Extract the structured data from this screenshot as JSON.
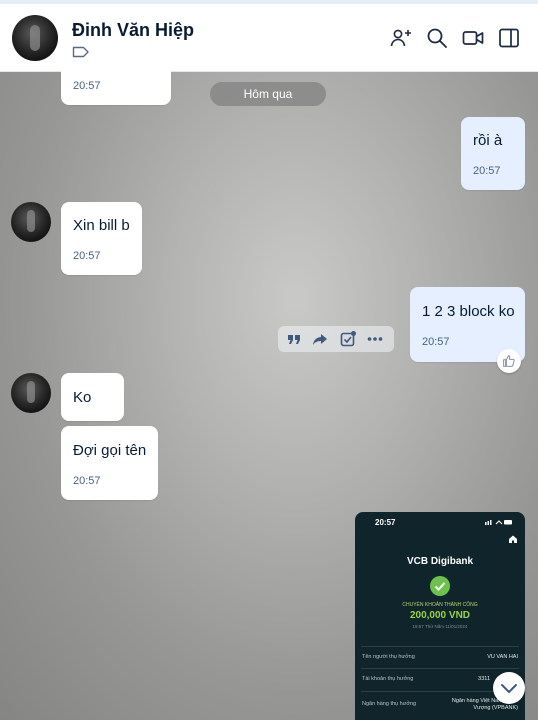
{
  "header": {
    "contact_name": "Đinh Văn Hiệp"
  },
  "chat": {
    "date_separator": "Hôm qua",
    "messages": [
      {
        "side": "other",
        "text": "",
        "time": "20:57"
      },
      {
        "side": "me",
        "text": "rồi à",
        "time": "20:57"
      },
      {
        "side": "other",
        "text": "Xin bill b",
        "time": "20:57"
      },
      {
        "side": "me",
        "text": "1 2 3 block ko",
        "time": "20:57"
      },
      {
        "side": "other",
        "text": "Ko",
        "time": ""
      },
      {
        "side": "other",
        "text": "Đợi gọi tên",
        "time": "20:57"
      }
    ],
    "receipt": {
      "phone_time": "20:57",
      "brand": "VCB Digibank",
      "status": "CHUYỂN KHOẢN THÀNH CÔNG",
      "amount": "200,000 VND",
      "datetime": "19:57 Thứ Năm 11/01/2024",
      "rows": [
        {
          "label": "Tên người thụ hưởng",
          "value": "VU VAN HAI"
        },
        {
          "label": "Tài khoản thụ hưởng",
          "value": "3311"
        },
        {
          "label": "Ngân hàng thụ hưởng",
          "value": "Ngân hàng Việt Nam Thịnh Vượng (VPBANK)"
        }
      ]
    }
  },
  "colors": {
    "accent": "#0068ff",
    "bubble_me": "#e5efff",
    "bubble_other": "#ffffff",
    "name_text": "#081c36",
    "time_text": "#476285"
  },
  "icons": [
    "add-member-icon",
    "search-icon",
    "video-call-icon",
    "sidebar-toggle-icon",
    "tag-icon",
    "quote-icon",
    "forward-icon",
    "task-icon",
    "more-icon",
    "like-icon",
    "chevron-down-icon"
  ]
}
